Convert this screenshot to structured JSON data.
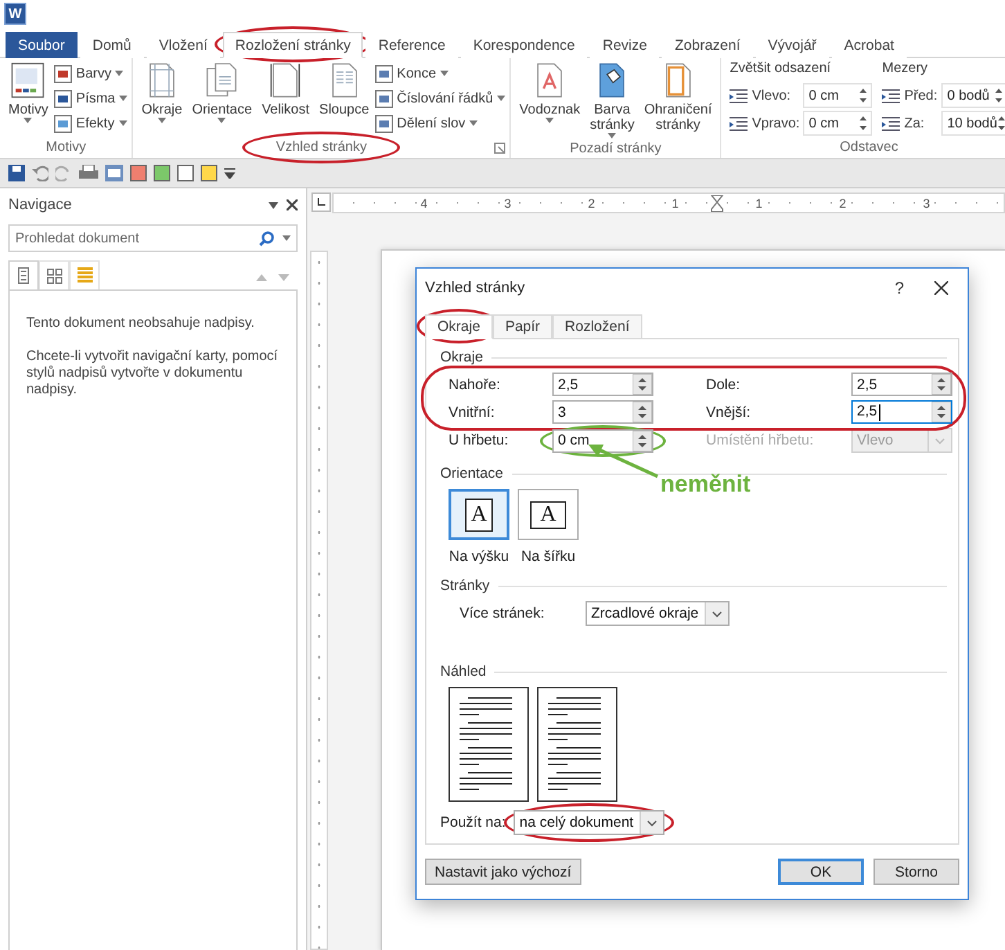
{
  "app_logo": "W",
  "tabs": [
    {
      "label": "Soubor",
      "kind": "file",
      "selected": false,
      "circled": false
    },
    {
      "label": "Domů",
      "kind": "tab",
      "selected": false,
      "circled": false
    },
    {
      "label": "Vložení",
      "kind": "tab",
      "selected": false,
      "circled": false
    },
    {
      "label": "Rozložení stránky",
      "kind": "tab",
      "selected": true,
      "circled": true
    },
    {
      "label": "Reference",
      "kind": "tab",
      "selected": false,
      "circled": false
    },
    {
      "label": "Korespondence",
      "kind": "tab",
      "selected": false,
      "circled": false
    },
    {
      "label": "Revize",
      "kind": "tab",
      "selected": false,
      "circled": false
    },
    {
      "label": "Zobrazení",
      "kind": "tab",
      "selected": false,
      "circled": false
    },
    {
      "label": "Vývojář",
      "kind": "tab",
      "selected": false,
      "circled": false
    },
    {
      "label": "Acrobat",
      "kind": "tab",
      "selected": false,
      "circled": false
    }
  ],
  "ribbon": {
    "groups": [
      {
        "label": "Motivy",
        "kind": "buttons",
        "circled": false,
        "launcher": false,
        "large": [
          {
            "label": "Motivy",
            "dropdown": true
          }
        ],
        "small": [
          {
            "label": "Barvy",
            "dropdown": true
          },
          {
            "label": "Písma",
            "dropdown": true
          },
          {
            "label": "Efekty",
            "dropdown": true
          }
        ]
      },
      {
        "label": "Vzhled stránky",
        "kind": "buttons",
        "circled": true,
        "launcher": true,
        "large": [
          {
            "label": "Okraje",
            "dropdown": true
          },
          {
            "label": "Orientace",
            "dropdown": true
          },
          {
            "label": "Velikost",
            "dropdown": false
          },
          {
            "label": "Sloupce",
            "dropdown": false
          }
        ],
        "small": [
          {
            "label": "Konce",
            "dropdown": true
          },
          {
            "label": "Číslování řádků",
            "dropdown": true
          },
          {
            "label": "Dělení slov",
            "dropdown": true
          }
        ]
      },
      {
        "label": "Pozadí stránky",
        "kind": "buttons",
        "circled": false,
        "launcher": false,
        "large": [
          {
            "label": "Vodoznak",
            "dropdown": true
          },
          {
            "label": "Barva stránky",
            "dropdown": true
          },
          {
            "label": "Ohraničení stránky",
            "dropdown": false
          }
        ]
      },
      {
        "label": "Odstavec",
        "kind": "paragraph",
        "circled": false,
        "launcher": false,
        "columns": [
          {
            "title": "Zvětšit odsazení",
            "rows": [
              {
                "label": "Vlevo:",
                "value": "0 cm"
              },
              {
                "label": "Vpravo:",
                "value": "0 cm"
              }
            ]
          },
          {
            "title": "Mezery",
            "rows": [
              {
                "label": "Před:",
                "value": "0 bodů"
              },
              {
                "label": "Za:",
                "value": "10 bodů"
              }
            ]
          }
        ]
      }
    ]
  },
  "navigation": {
    "title": "Navigace",
    "search": {
      "placeholder": "Prohledat dokument"
    },
    "view_tabs": [
      {
        "selected": true
      },
      {
        "selected": false
      },
      {
        "selected": false
      }
    ],
    "messages": [
      "Tento dokument neobsahuje nadpisy.",
      "Chcete-li vytvořit navigační karty, pomocí stylů nadpisů vytvořte v dokumentu nadpisy."
    ]
  },
  "ruler": {
    "marks": [
      {
        "kind": "number",
        "text": "4"
      },
      {
        "kind": "number",
        "text": "3"
      },
      {
        "kind": "number",
        "text": "2"
      },
      {
        "kind": "number",
        "text": "1"
      },
      {
        "kind": "marker"
      },
      {
        "kind": "number",
        "text": "1"
      },
      {
        "kind": "number",
        "text": "2"
      },
      {
        "kind": "number",
        "text": "3"
      }
    ]
  },
  "dialog": {
    "title": "Vzhled stránky",
    "help": "?",
    "tabs": [
      {
        "label": "Okraje",
        "selected": true,
        "circled": true
      },
      {
        "label": "Papír",
        "selected": false,
        "circled": false
      },
      {
        "label": "Rozložení",
        "selected": false,
        "circled": false
      }
    ],
    "margins": {
      "title": "Okraje",
      "circled": true,
      "fields": [
        {
          "label": "Nahoře:",
          "value": "2,5",
          "focused": false
        },
        {
          "label": "Dole:",
          "value": "2,5",
          "focused": false
        },
        {
          "label": "Vnitřní:",
          "value": "3",
          "focused": false
        },
        {
          "label": "Vnější:",
          "value": "2,5",
          "focused": true
        }
      ]
    },
    "gutter": {
      "label": "U hřbetu:",
      "value": "0 cm",
      "circled": true,
      "note": "neměnit",
      "position_label": "Umístění hřbetu:",
      "position_value": "Vlevo",
      "position_disabled": true
    },
    "orientation": {
      "title": "Orientace",
      "options": [
        {
          "label": "Na výšku",
          "glyph": "A",
          "selected": true
        },
        {
          "label": "Na šířku",
          "glyph": "A",
          "selected": false
        }
      ]
    },
    "pages": {
      "title": "Stránky",
      "label": "Více stránek:",
      "value": "Zrcadlové okraje"
    },
    "preview": {
      "title": "Náhled"
    },
    "apply": {
      "label": "Použít na:",
      "value": "na celý dokument",
      "circled": true
    },
    "buttons": [
      {
        "label": "Nastavit jako výchozí",
        "kind": "secondary"
      },
      {
        "label": "OK",
        "kind": "default"
      },
      {
        "label": "Storno",
        "kind": "normal"
      }
    ]
  }
}
